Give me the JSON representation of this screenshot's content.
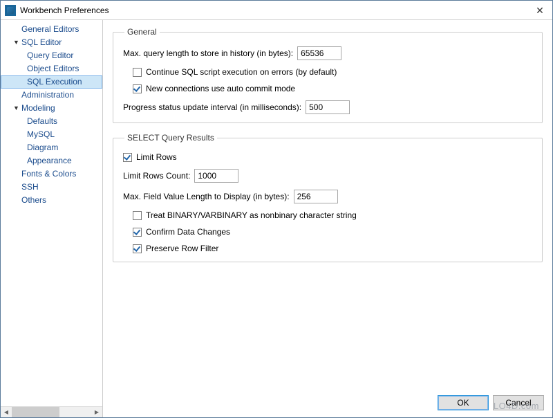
{
  "window": {
    "title": "Workbench Preferences"
  },
  "sidebar": {
    "items": [
      {
        "label": "General Editors",
        "level": 1,
        "expander": ""
      },
      {
        "label": "SQL Editor",
        "level": 1,
        "expander": "▼"
      },
      {
        "label": "Query Editor",
        "level": 2,
        "expander": ""
      },
      {
        "label": "Object Editors",
        "level": 2,
        "expander": ""
      },
      {
        "label": "SQL Execution",
        "level": 2,
        "expander": "",
        "selected": true
      },
      {
        "label": "Administration",
        "level": 1,
        "expander": ""
      },
      {
        "label": "Modeling",
        "level": 1,
        "expander": "▼"
      },
      {
        "label": "Defaults",
        "level": 2,
        "expander": ""
      },
      {
        "label": "MySQL",
        "level": 2,
        "expander": ""
      },
      {
        "label": "Diagram",
        "level": 2,
        "expander": ""
      },
      {
        "label": "Appearance",
        "level": 2,
        "expander": ""
      },
      {
        "label": "Fonts & Colors",
        "level": 1,
        "expander": ""
      },
      {
        "label": "SSH",
        "level": 1,
        "expander": ""
      },
      {
        "label": "Others",
        "level": 1,
        "expander": ""
      }
    ]
  },
  "general": {
    "legend": "General",
    "max_query_label": "Max. query length to store in history (in bytes):",
    "max_query_value": "65536",
    "continue_on_error": {
      "label": "Continue SQL script execution on errors (by default)",
      "checked": false
    },
    "auto_commit": {
      "label": "New connections use auto commit mode",
      "checked": true
    },
    "progress_label": "Progress status update interval (in milliseconds):",
    "progress_value": "500"
  },
  "select_results": {
    "legend": "SELECT Query Results",
    "limit_rows": {
      "label": "Limit Rows",
      "checked": true
    },
    "limit_count_label": "Limit Rows Count:",
    "limit_count_value": "1000",
    "max_field_label": "Max. Field Value Length to Display (in bytes):",
    "max_field_value": "256",
    "treat_binary": {
      "label": "Treat BINARY/VARBINARY as nonbinary character string",
      "checked": false
    },
    "confirm_changes": {
      "label": "Confirm Data Changes",
      "checked": true
    },
    "preserve_filter": {
      "label": "Preserve Row Filter",
      "checked": true
    }
  },
  "buttons": {
    "ok": "OK",
    "cancel": "Cancel"
  },
  "watermark": "LO4D.com"
}
